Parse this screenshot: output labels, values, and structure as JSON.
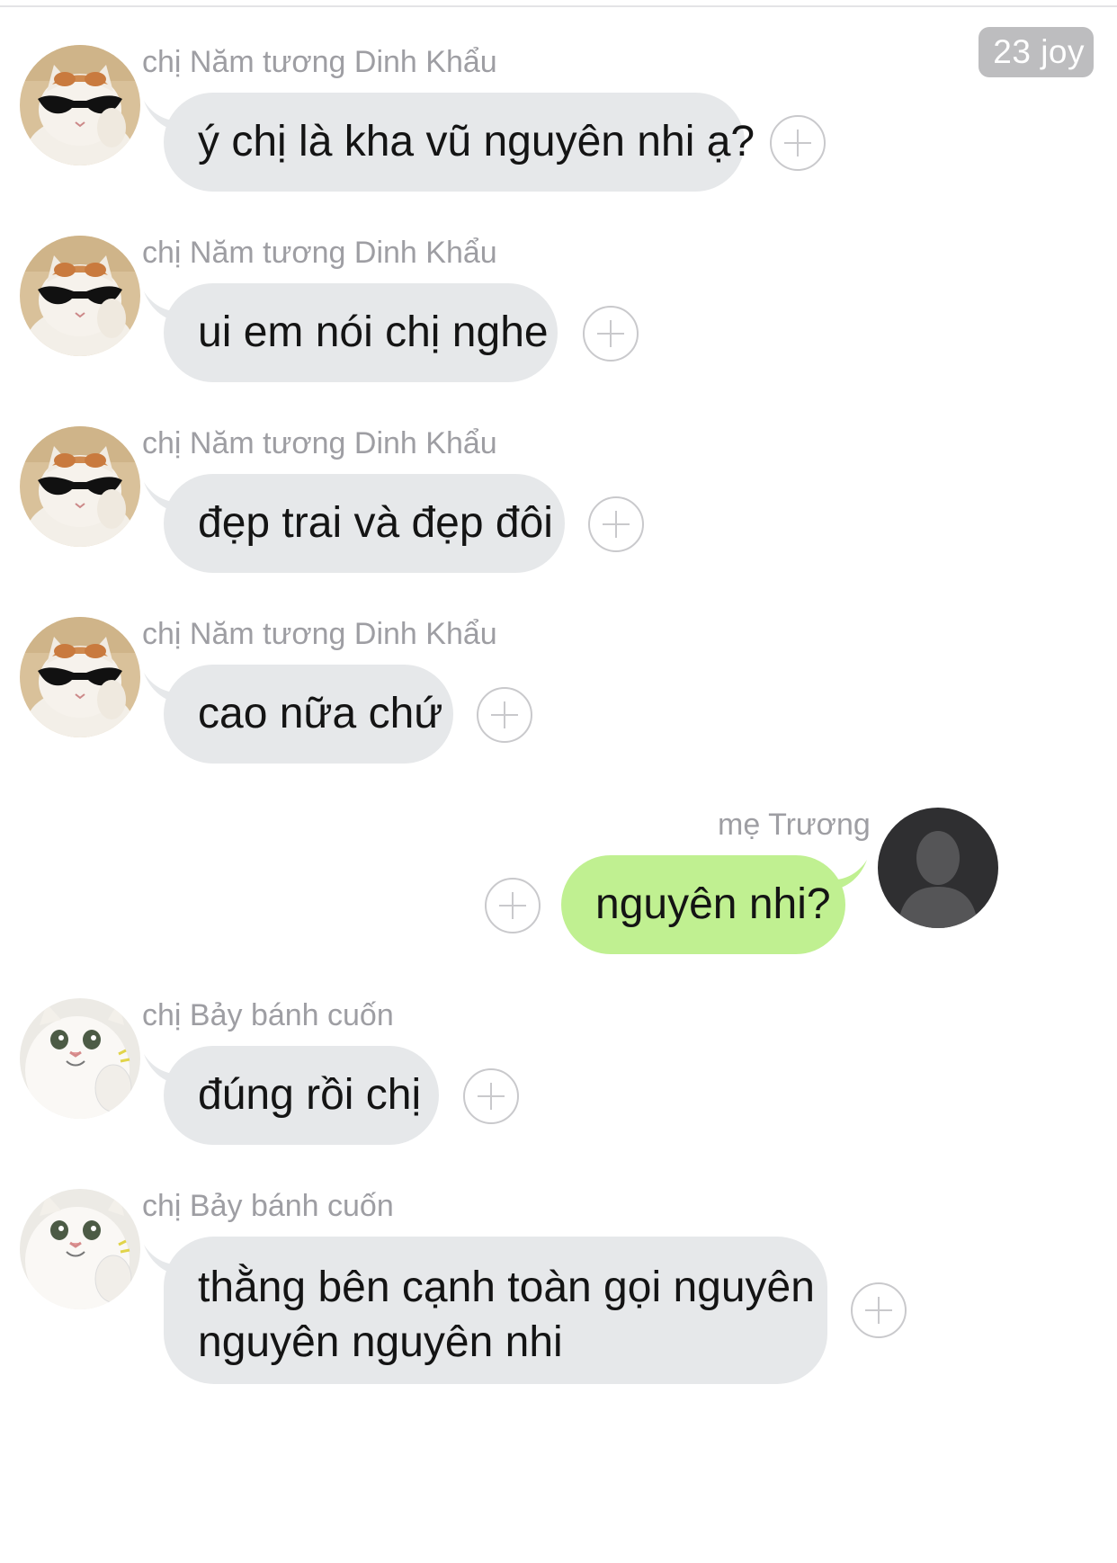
{
  "header": {
    "badge_text": "23 joy"
  },
  "colors": {
    "incoming_bubble": "#e6e8ea",
    "outgoing_bubble": "#c0f091",
    "sender_name": "#9e9ea3",
    "badge_bg": "#bdbdbf"
  },
  "messages": [
    {
      "sender": "chị Năm tương Dinh Khẩu",
      "text": "ý chị là kha vũ nguyên nhi ạ?",
      "direction": "incoming",
      "avatar": "cat-sunglasses-avatar"
    },
    {
      "sender": "chị Năm tương Dinh Khẩu",
      "text": "ui em nói chị nghe",
      "direction": "incoming",
      "avatar": "cat-sunglasses-avatar"
    },
    {
      "sender": "chị Năm tương Dinh Khẩu",
      "text": "đẹp trai và đẹp đôi",
      "direction": "incoming",
      "avatar": "cat-sunglasses-avatar"
    },
    {
      "sender": "chị Năm tương Dinh Khẩu",
      "text": "cao nữa chứ",
      "direction": "incoming",
      "avatar": "cat-sunglasses-avatar"
    },
    {
      "sender": "mẹ Trương",
      "text": "nguyên nhi?",
      "direction": "outgoing",
      "avatar": "default-user-avatar"
    },
    {
      "sender": "chị Bảy bánh cuốn",
      "text": "đúng rồi chị",
      "direction": "incoming",
      "avatar": "cat-cheering-avatar"
    },
    {
      "sender": "chị Bảy bánh cuốn",
      "text_line1": "thằng bên cạnh toàn gọi nguyên",
      "text_line2": "nguyên nguyên nhi",
      "direction": "incoming",
      "avatar": "cat-cheering-avatar"
    }
  ]
}
